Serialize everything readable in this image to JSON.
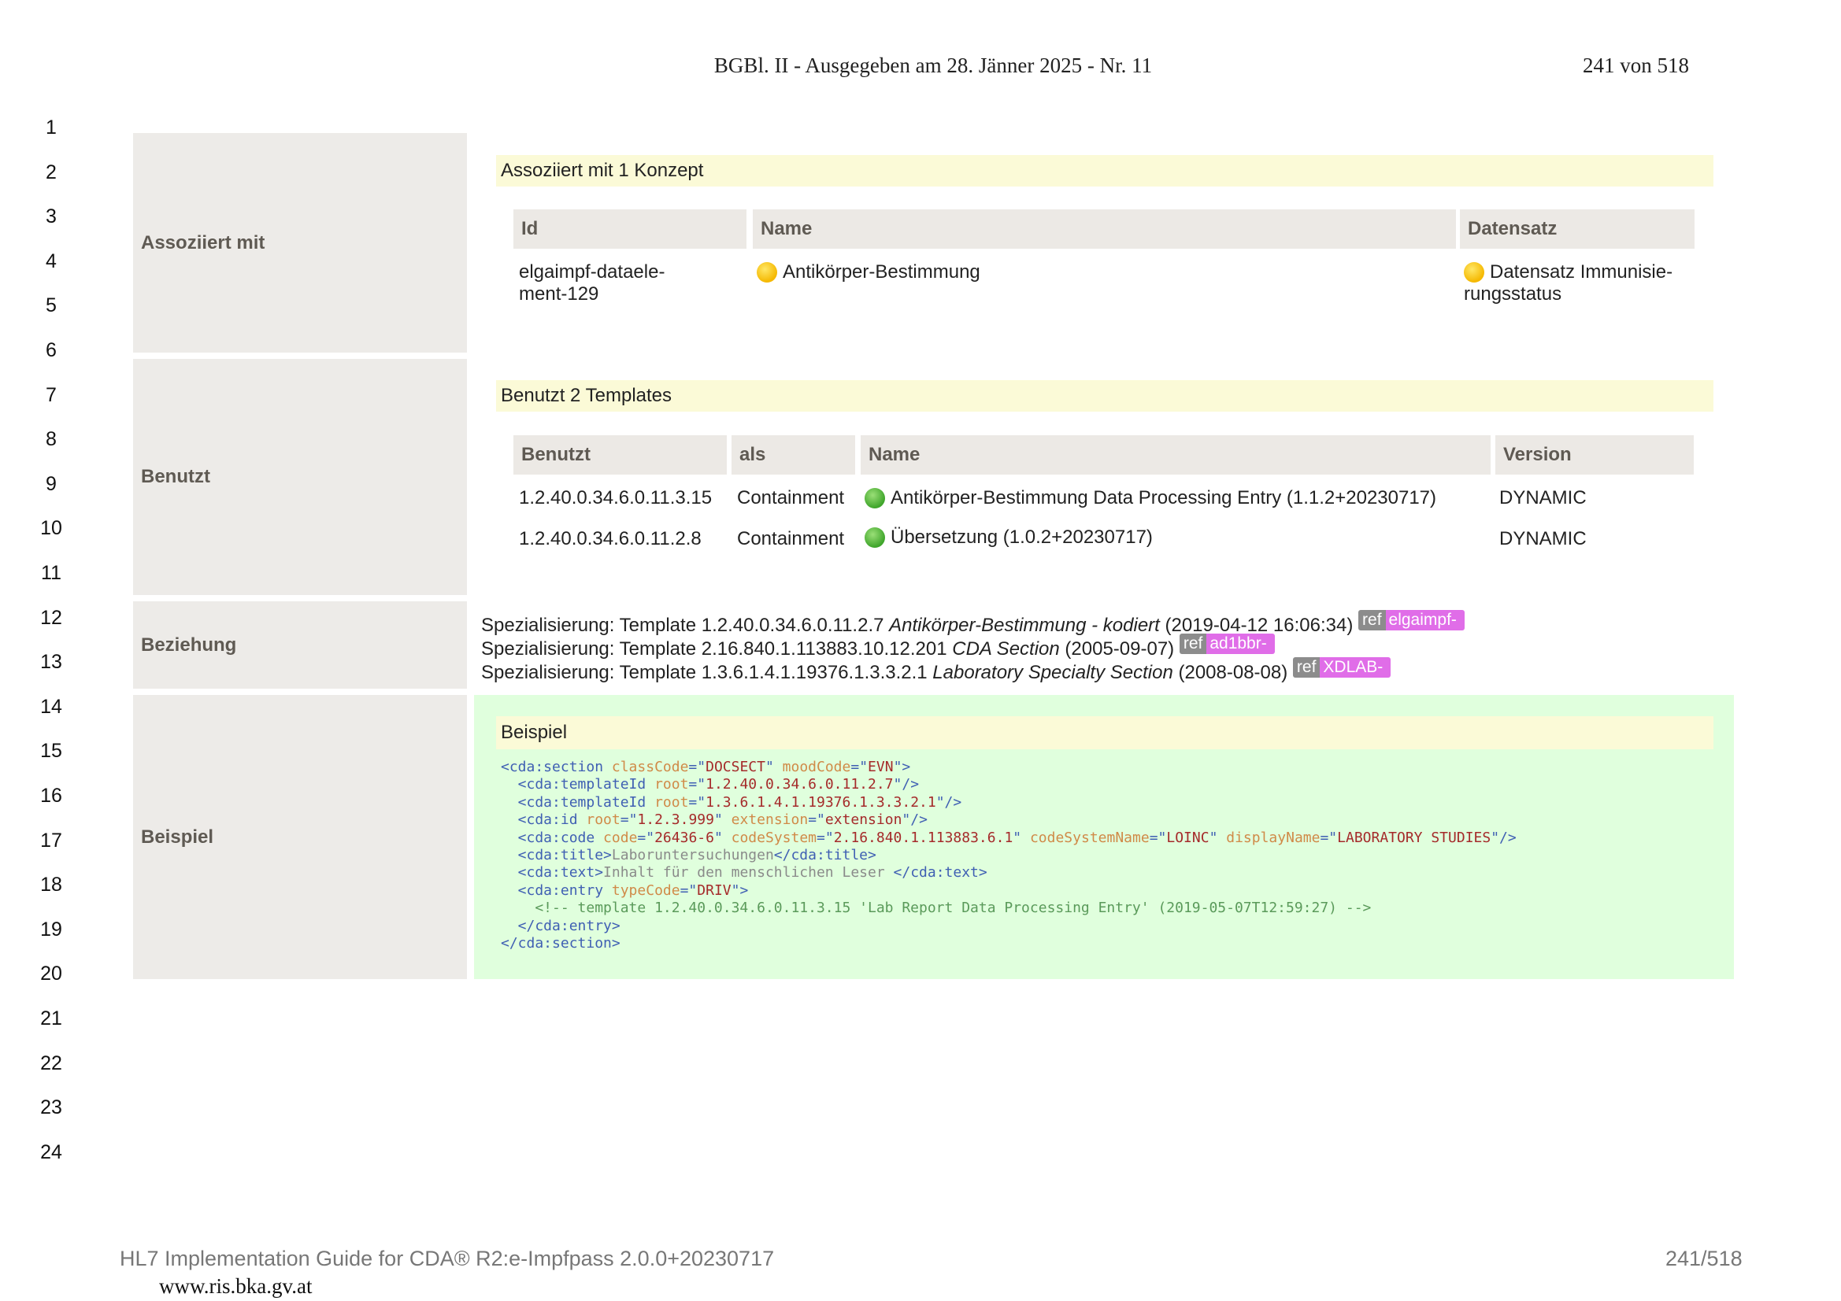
{
  "page_header": {
    "title": "BGBl. II - Ausgegeben am 28. Jänner 2025 - Nr. 11",
    "page": "241 von 518"
  },
  "line_numbers": [
    "1",
    "2",
    "3",
    "4",
    "5",
    "6",
    "7",
    "8",
    "9",
    "10",
    "11",
    "12",
    "13",
    "14",
    "15",
    "16",
    "17",
    "18",
    "19",
    "20",
    "21",
    "22",
    "23",
    "24"
  ],
  "rows": {
    "associated": {
      "label": "Assoziiert mit",
      "bar": "Assoziiert mit 1 Konzept",
      "headers": [
        "Id",
        "Name",
        "Datensatz"
      ],
      "cells": {
        "id_line1": "elgaimpf-dataele-",
        "id_line2": "ment-129",
        "name": "Antikörper-Bestimmung",
        "dataset_line1": "Datensatz Immunisie-",
        "dataset_line2": "rungsstatus"
      }
    },
    "uses": {
      "label": "Benutzt",
      "bar": "Benutzt 2 Templates",
      "headers": [
        "Benutzt",
        "als",
        "Name",
        "Version"
      ],
      "rows": [
        {
          "id": "1.2.40.0.34.6.0.11.3.15",
          "as": "Containment",
          "name": "Antikörper-Bestimmung Data Processing Entry (1.1.2+20230717)",
          "version": "DYNAMIC"
        },
        {
          "id": "1.2.40.0.34.6.0.11.2.8",
          "as": "Containment",
          "name": "Übersetzung (1.0.2+20230717)",
          "version": "DYNAMIC"
        }
      ]
    },
    "relation": {
      "label": "Beziehung",
      "items": [
        {
          "prefix": "Spezialisierung: Template 1.2.40.0.34.6.0.11.2.7 ",
          "name": "Antikörper-Bestimmung - kodiert",
          "date": " (2019‑04‑12 16:06:34) ",
          "ref": "ref",
          "ref_target": "elgaimpf-"
        },
        {
          "prefix": "Spezialisierung: Template 2.16.840.1.113883.10.12.201 ",
          "name": "CDA Section",
          "date": " (2005‑09‑07) ",
          "ref": "ref",
          "ref_target": "ad1bbr-"
        },
        {
          "prefix": "Spezialisierung: Template 1.3.6.1.4.1.19376.1.3.3.2.1 ",
          "name": "Laboratory Specialty Section",
          "date": " (2008‑08‑08) ",
          "ref": "ref",
          "ref_target": "XDLAB-"
        }
      ]
    },
    "example": {
      "label": "Beispiel",
      "bar": "Beispiel",
      "code": {
        "l1": {
          "t1": "<cda:section",
          "a1": " classCode",
          "e1": "=\"",
          "v1": "DOCSECT",
          "e2": "\"",
          "a2": " moodCode",
          "e3": "=\"",
          "v2": "EVN",
          "e4": "\">"
        },
        "l2": {
          "t1": "  <cda:templateId",
          "a1": " root",
          "e1": "=\"",
          "v1": "1.2.40.0.34.6.0.11.2.7",
          "e2": "\"/>"
        },
        "l3": {
          "t1": "  <cda:templateId",
          "a1": " root",
          "e1": "=\"",
          "v1": "1.3.6.1.4.1.19376.1.3.3.2.1",
          "e2": "\"/>"
        },
        "l4": {
          "t1": "  <cda:id",
          "a1": " root",
          "e1": "=\"",
          "v1": "1.2.3.999",
          "e2": "\"",
          "a2": " extension",
          "e3": "=\"",
          "v2": "extension",
          "e4": "\"/>"
        },
        "l5": {
          "t1": "  <cda:code",
          "a1": " code",
          "e1": "=\"",
          "v1": "26436-6",
          "e2": "\"",
          "a2": " codeSystem",
          "e3": "=\"",
          "v2": "2.16.840.1.113883.6.1",
          "e4": "\"",
          "a3": " codeSystemName",
          "e5": "=\"",
          "v3": "LOINC",
          "e6": "\"",
          "a4": " displayName",
          "e7": "=\"",
          "v4": "LABORATORY STUDIES",
          "e8": "\"/>"
        },
        "l6": {
          "t1": "  <cda:title>",
          "x1": "Laboruntersuchungen",
          "t2": "</cda:title>"
        },
        "l7": {
          "t1": "  <cda:text>",
          "x1": "Inhalt für den menschlichen Leser ",
          "t2": "</cda:text>"
        },
        "l8": {
          "t1": "  <cda:entry",
          "a1": " typeCode",
          "e1": "=\"",
          "v1": "DRIV",
          "e2": "\">"
        },
        "l9": {
          "c1": "    <!-- template 1.2.40.0.34.6.0.11.3.15 'Lab Report Data Processing Entry' (2019-05-07T12:59:27) -->"
        },
        "l10": {
          "t1": "  </cda:entry>"
        },
        "l11": {
          "t1": "</cda:section>"
        }
      }
    }
  },
  "footer": {
    "title": "HL7 Implementation Guide for CDA® R2:e-Impfpass 2.0.0+20230717",
    "page": "241/518",
    "url": "www.ris.bka.gv.at"
  }
}
